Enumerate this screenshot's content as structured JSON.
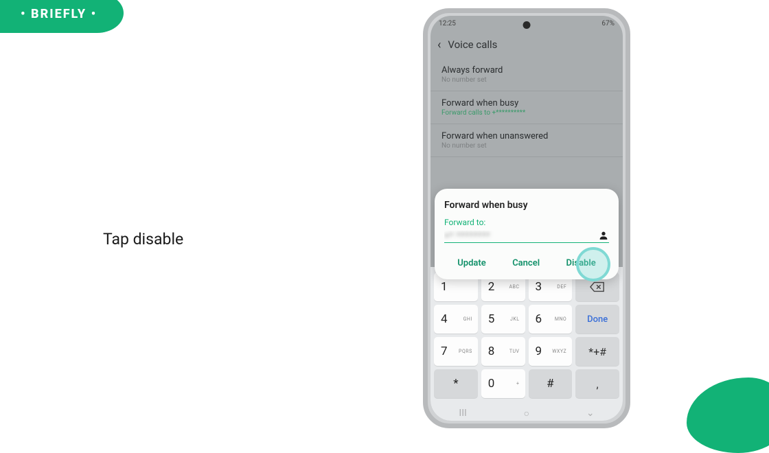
{
  "brand": "• BRIEFLY •",
  "instruction": "Tap disable",
  "statusbar": {
    "time": "12:25",
    "right": "67%"
  },
  "header": {
    "title": "Voice calls"
  },
  "settings": [
    {
      "title": "Always forward",
      "sub": "No number set",
      "sub_grey": true
    },
    {
      "title": "Forward when busy",
      "sub": "Forward calls to +**********",
      "sub_grey": false
    },
    {
      "title": "Forward when unanswered",
      "sub": "No number set",
      "sub_grey": true
    }
  ],
  "dialog": {
    "title": "Forward when busy",
    "label": "Forward to:",
    "value": "+* ********",
    "actions": {
      "update": "Update",
      "cancel": "Cancel",
      "disable": "Disable"
    }
  },
  "keypad": {
    "rows": [
      [
        {
          "n": "1",
          "l": ""
        },
        {
          "n": "2",
          "l": "ABC"
        },
        {
          "n": "3",
          "l": "DEF"
        },
        {
          "type": "back"
        }
      ],
      [
        {
          "n": "4",
          "l": "GHI"
        },
        {
          "n": "5",
          "l": "JKL"
        },
        {
          "n": "6",
          "l": "MNO"
        },
        {
          "type": "done",
          "label": "Done"
        }
      ],
      [
        {
          "n": "7",
          "l": "PQRS"
        },
        {
          "n": "8",
          "l": "TUV"
        },
        {
          "n": "9",
          "l": "WXYZ"
        },
        {
          "type": "sym",
          "label": "*+#"
        }
      ],
      [
        {
          "n": "*",
          "l": "",
          "grey": true,
          "center": true
        },
        {
          "n": "0",
          "l": "+"
        },
        {
          "n": "#",
          "l": "",
          "grey": true,
          "center": true
        },
        {
          "type": "sym",
          "label": ",",
          "grey": true
        }
      ]
    ]
  }
}
